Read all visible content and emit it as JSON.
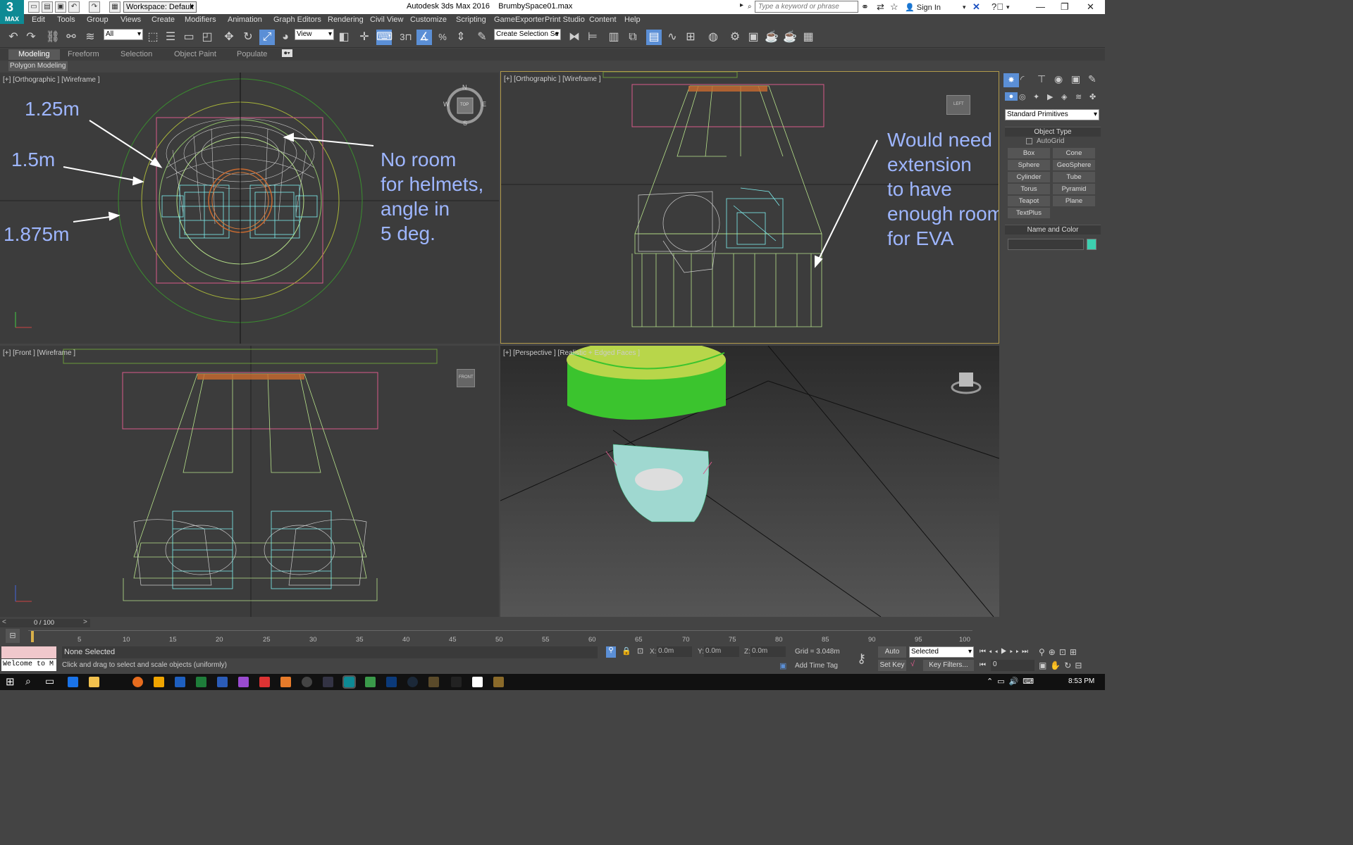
{
  "title": {
    "app": "Autodesk 3ds Max 2016",
    "file": "BrumbySpace01.max",
    "workspace": "Workspace: Default",
    "search_placeholder": "Type a keyword or phrase",
    "sign_in": "Sign In",
    "logo": "MAX"
  },
  "menu": [
    "Edit",
    "Tools",
    "Group",
    "Views",
    "Create",
    "Modifiers",
    "Animation",
    "Graph Editors",
    "Rendering",
    "Civil View",
    "Customize",
    "Scripting",
    "GameExporter",
    "Print Studio",
    "Content",
    "Help"
  ],
  "toolbar": {
    "filter": "All",
    "ref_coord": "View",
    "selection_set": "Create Selection Se",
    "snap_label": "3"
  },
  "ribbon": {
    "tabs": [
      "Modeling",
      "Freeform",
      "Selection",
      "Object Paint",
      "Populate"
    ],
    "panel": "Polygon Modeling"
  },
  "viewports": {
    "top_left": {
      "label": "[+] [Orthographic ] [Wireframe ]",
      "notes": [
        "1.25m",
        "1.5m",
        "1.875m",
        "No room\nfor helmets,\nangle in\n5 deg."
      ],
      "compass": [
        "N",
        "E",
        "S",
        "W",
        "TOP"
      ]
    },
    "top_right": {
      "label": "[+] [Orthographic ] [Wireframe ]",
      "notes": [
        "Would need\nextension\nto have\nenough room\nfor EVA"
      ],
      "cube": "LEFT"
    },
    "bottom_left": {
      "label": "[+] [Front ] [Wireframe ]",
      "cube": "FRONT"
    },
    "bottom_right": {
      "label": "[+] [Perspective ] [Realistic + Edged Faces ]"
    }
  },
  "command_panel": {
    "category": "Standard Primitives",
    "object_type_title": "Object Type",
    "autogrid": "AutoGrid",
    "buttons": [
      "Box",
      "Cone",
      "Sphere",
      "GeoSphere",
      "Cylinder",
      "Tube",
      "Torus",
      "Pyramid",
      "Teapot",
      "Plane",
      "TextPlus"
    ],
    "name_color_title": "Name and Color",
    "swatch_color": "#3cd0b0"
  },
  "timeline": {
    "frame": "0 / 100",
    "ticks": [
      "5",
      "10",
      "15",
      "20",
      "25",
      "30",
      "35",
      "40",
      "45",
      "50",
      "55",
      "60",
      "65",
      "70",
      "75",
      "80",
      "85",
      "90",
      "95",
      "100"
    ]
  },
  "status": {
    "selected": "None Selected",
    "prompt": "Click and drag to select and scale objects (uniformly)",
    "maxscript": "Welcome to M",
    "x": "0.0m",
    "y": "0.0m",
    "z": "0.0m",
    "grid": "Grid = 3.048m",
    "auto_key": "Auto Key",
    "set_key": "Set Key",
    "key_mode": "Selected",
    "key_filters": "Key Filters...",
    "add_time_tag": "Add Time Tag",
    "frame_field": "0"
  },
  "taskbar": {
    "time": "8:53 PM"
  }
}
